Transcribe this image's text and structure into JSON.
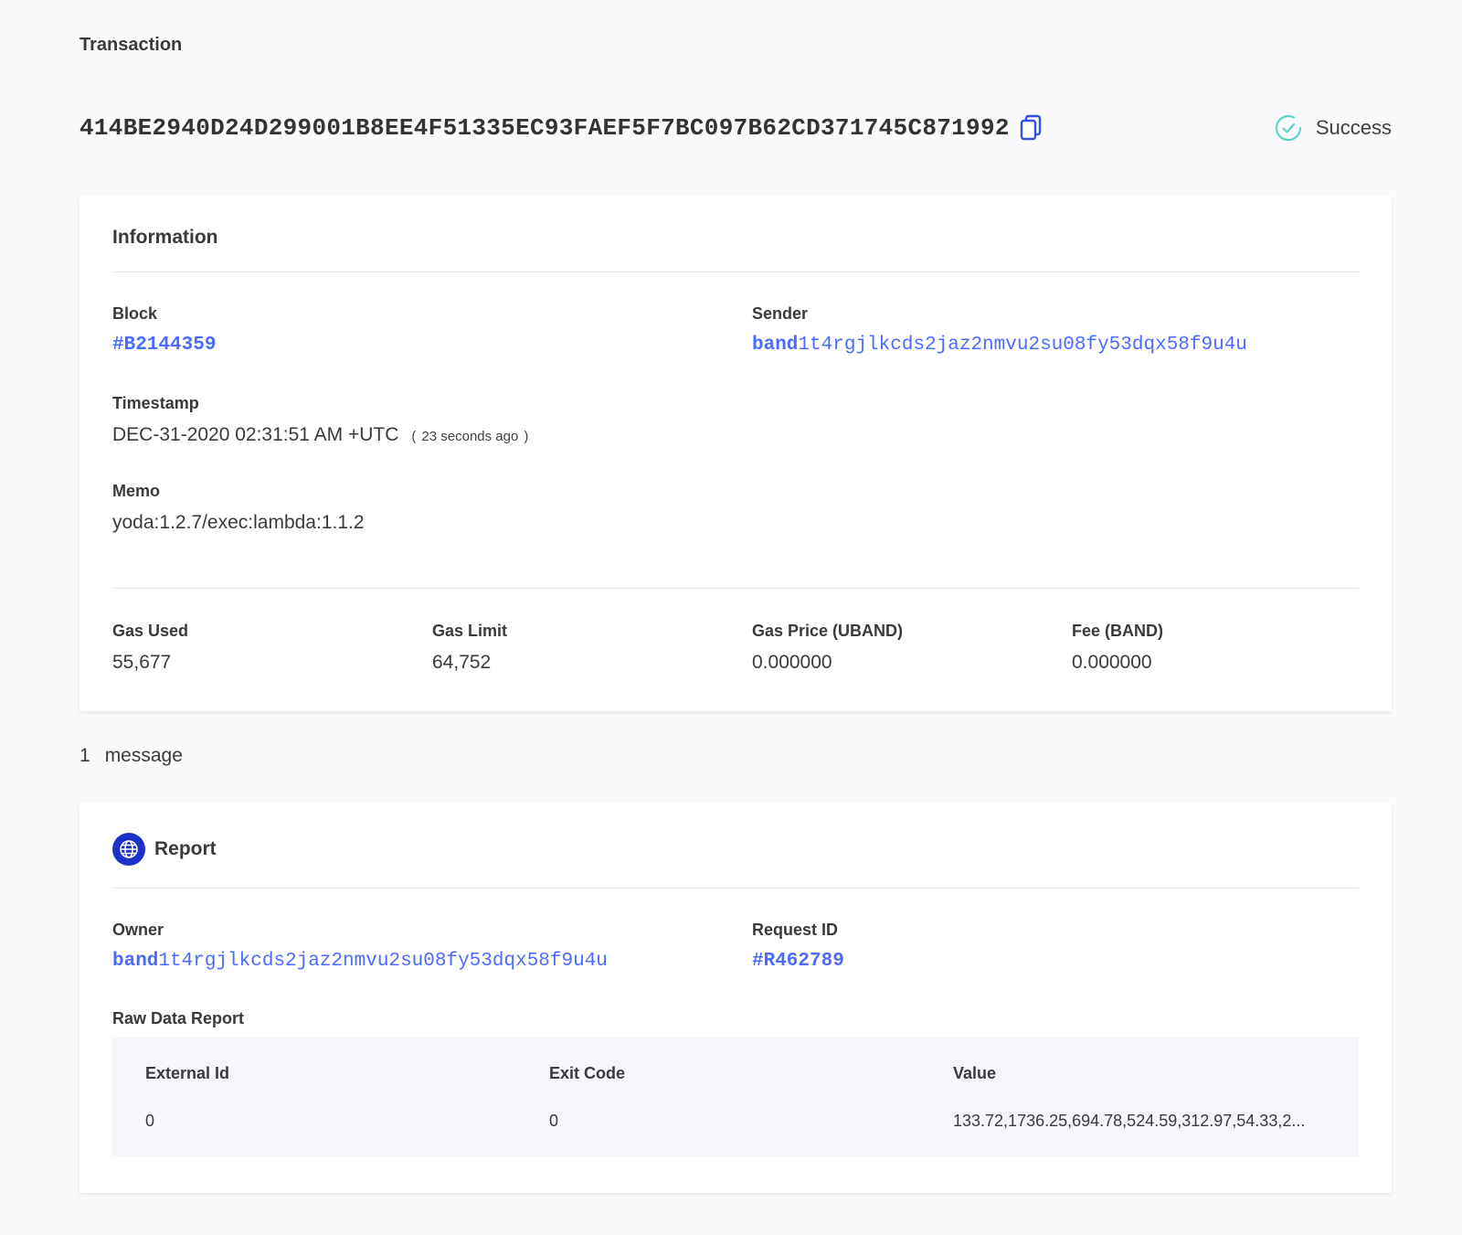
{
  "header": {
    "label": "Transaction",
    "hash": "414BE2940D24D299001B8EE4F51335EC93FAEF5F7BC097B62CD371745C871992",
    "status": "Success"
  },
  "information": {
    "title": "Information",
    "block_label": "Block",
    "block_value": "#B2144359",
    "sender_label": "Sender",
    "sender_prefix": "band",
    "sender_rest": "1t4rgjlkcds2jaz2nmvu2su08fy53dqx58f9u4u",
    "timestamp_label": "Timestamp",
    "timestamp_value": "DEC-31-2020 02:31:51 AM +UTC",
    "timestamp_ago_open": "(",
    "timestamp_ago": "23 seconds ago",
    "timestamp_ago_close": ")",
    "memo_label": "Memo",
    "memo_value": "yoda:1.2.7/exec:lambda:1.1.2",
    "gas_used_label": "Gas Used",
    "gas_used_value": "55,677",
    "gas_limit_label": "Gas Limit",
    "gas_limit_value": "64,752",
    "gas_price_label": "Gas Price (UBAND)",
    "gas_price_value": "0.000000",
    "fee_label": "Fee (BAND)",
    "fee_value": "0.000000"
  },
  "messages": {
    "count": "1",
    "label": "message"
  },
  "report": {
    "title": "Report",
    "owner_label": "Owner",
    "owner_prefix": "band",
    "owner_rest": "1t4rgjlkcds2jaz2nmvu2su08fy53dqx58f9u4u",
    "request_label": "Request ID",
    "request_value": "#R462789",
    "raw_label": "Raw Data Report",
    "raw_headers": [
      "External Id",
      "Exit Code",
      "Value"
    ],
    "raw_rows": [
      [
        "0",
        "0",
        "133.72,1736.25,694.78,524.59,312.97,54.33,2..."
      ]
    ]
  },
  "colors": {
    "accent": "#4b6bff",
    "success": "#5fd3c8",
    "report_icon_bg": "#1b32c8"
  },
  "icons": {
    "copy": "copy-icon",
    "status": "check-circle-icon",
    "report": "globe-icon"
  }
}
